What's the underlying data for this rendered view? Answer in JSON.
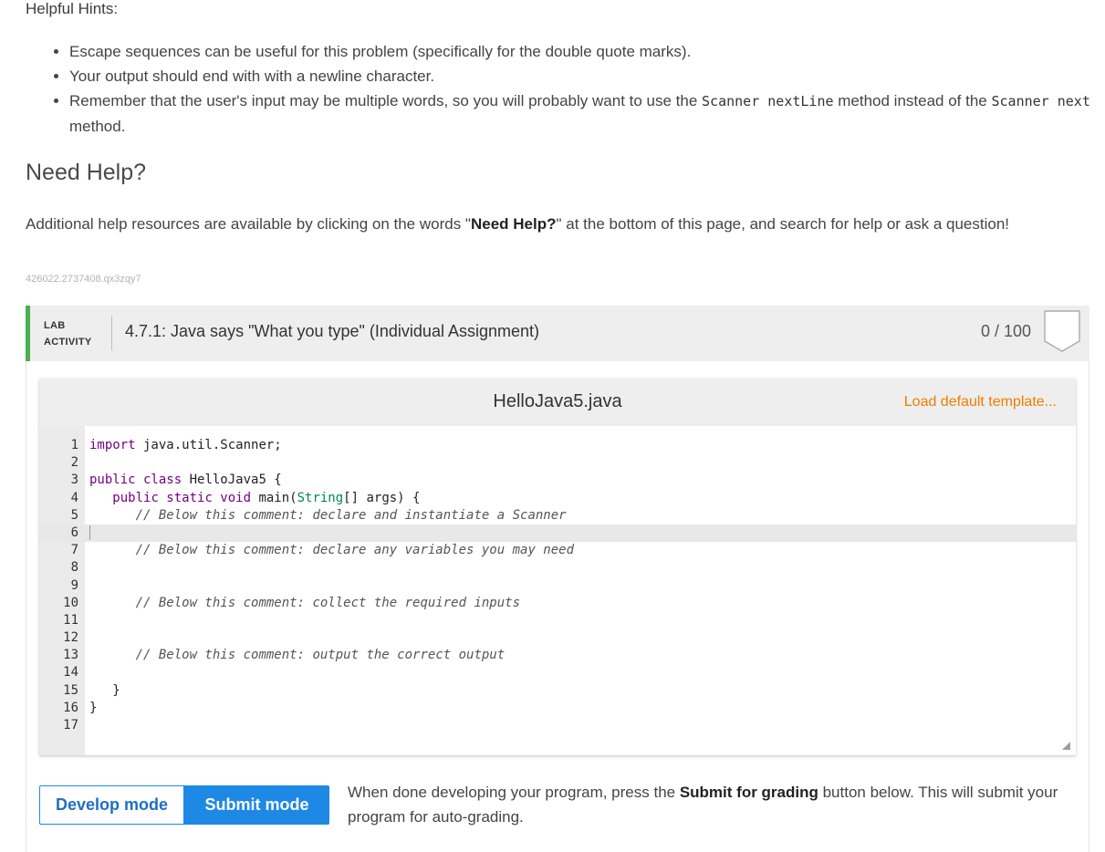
{
  "hints": {
    "title": "Helpful Hints:",
    "items": [
      {
        "text": "Escape sequences can be useful for this problem (specifically for the double quote marks)."
      },
      {
        "text": "Your output should end with with a newline character."
      },
      {
        "pre": "Remember that the user's input may be multiple words, so you will probably want to use the ",
        "code1": "Scanner nextLine",
        "mid": " method instead of the ",
        "code2": "Scanner next",
        "post": " method."
      }
    ]
  },
  "need_help": {
    "heading": "Need Help?",
    "pre": "Additional help resources are available by clicking on the words \"",
    "bold": "Need Help?",
    "post": "\" at the bottom of this page, and search for help or ask a question!"
  },
  "tracking_id": "426022.2737408.qx3zqy7",
  "lab": {
    "label_line1": "LAB",
    "label_line2": "ACTIVITY",
    "title": "4.7.1: Java says \"What you type\" (Individual Assignment)",
    "score": "0 / 100",
    "accent_color": "#4caf50"
  },
  "editor": {
    "filename": "HelloJava5.java",
    "load_template": "Load default template...",
    "lines": [
      {
        "n": "1"
      },
      {
        "n": "2"
      },
      {
        "n": "3"
      },
      {
        "n": "4"
      },
      {
        "n": "5"
      },
      {
        "n": "6"
      },
      {
        "n": "7"
      },
      {
        "n": "8"
      },
      {
        "n": "9"
      },
      {
        "n": "10"
      },
      {
        "n": "11"
      },
      {
        "n": "12"
      },
      {
        "n": "13"
      },
      {
        "n": "14"
      },
      {
        "n": "15"
      },
      {
        "n": "16"
      },
      {
        "n": "17"
      }
    ],
    "code": {
      "l1_kw": "import",
      "l1_rest": " java.util.Scanner;",
      "l3_kw": "public class",
      "l3_rest": " HelloJava5 {",
      "l4_kw": "public static void",
      "l4_mid": " main(",
      "l4_type": "String",
      "l4_rest": "[] args) {",
      "l5_comment": "// Below this comment: declare and instantiate a Scanner",
      "l7_comment": "// Below this comment: declare any variables you may need",
      "l10_comment": "// Below this comment: collect the required inputs",
      "l13_comment": "// Below this comment: output the correct output",
      "l15_text": "}",
      "l16_text": "}"
    },
    "active_line": 6
  },
  "modes": {
    "develop": "Develop mode",
    "submit": "Submit mode",
    "active": "submit",
    "accent_color": "#1e88e5"
  },
  "submit_note": {
    "pre": "When done developing your program, press the ",
    "bold": "Submit for grading",
    "post": " button below. This will submit your program for auto-grading."
  }
}
